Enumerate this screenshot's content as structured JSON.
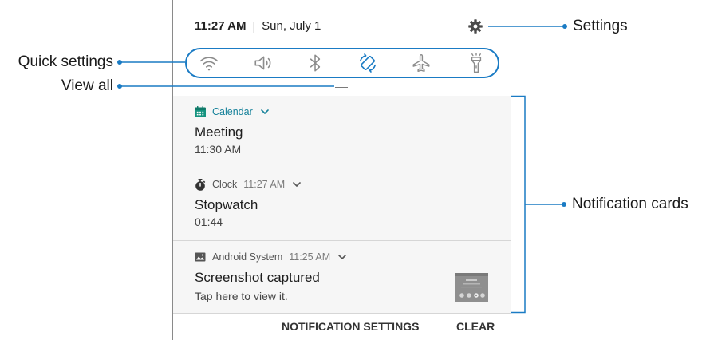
{
  "status_bar": {
    "time": "11:27 AM",
    "separator": "|",
    "date": "Sun, July 1",
    "settings_icon": "gear-icon"
  },
  "quick_settings": [
    {
      "icon": "wifi-icon",
      "active": false
    },
    {
      "icon": "volume-icon",
      "active": false
    },
    {
      "icon": "bluetooth-icon",
      "active": false
    },
    {
      "icon": "auto-rotate-icon",
      "active": true
    },
    {
      "icon": "airplane-mode-icon",
      "active": false
    },
    {
      "icon": "flashlight-icon",
      "active": false
    }
  ],
  "view_all_handle_icon": "drag-handle-icon",
  "notifications": [
    {
      "app": "Calendar",
      "app_icon": "calendar-icon",
      "expand_icon": "chevron-down-icon",
      "title": "Meeting",
      "text": "11:30 AM"
    },
    {
      "app": "Clock",
      "time": "11:27 AM",
      "app_icon": "stopwatch-icon",
      "expand_icon": "chevron-down-icon",
      "title": "Stopwatch",
      "text": "01:44"
    },
    {
      "app": "Android System",
      "time": "11:25 AM",
      "app_icon": "image-icon",
      "expand_icon": "chevron-down-icon",
      "title": "Screenshot captured",
      "text": "Tap here to view it."
    }
  ],
  "footer": {
    "settings_label": "NOTIFICATION SETTINGS",
    "clear_label": "CLEAR"
  },
  "callouts": {
    "settings": "Settings",
    "quick_settings": "Quick settings",
    "view_all": "View all",
    "notification_cards": "Notification cards"
  },
  "colors": {
    "callout_accent": "#1a7bc4",
    "active_toggle": "#1a7bc4",
    "calendar_app": "#17829b",
    "inactive_icon": "#8c8c8c"
  }
}
